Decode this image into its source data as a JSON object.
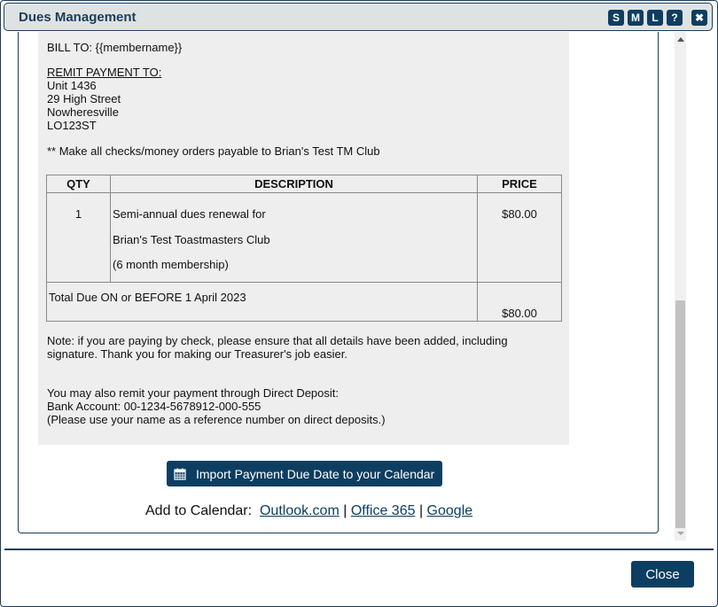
{
  "dialog": {
    "title": "Dues Management",
    "window_buttons": [
      {
        "label": "S",
        "name": "size-small-button"
      },
      {
        "label": "M",
        "name": "size-medium-button"
      },
      {
        "label": "L",
        "name": "size-large-button"
      },
      {
        "label": "?",
        "name": "help-button"
      },
      {
        "label": "✖",
        "name": "close-window-button"
      }
    ]
  },
  "invoice": {
    "bill_to": "BILL TO: {{membername}}",
    "remit_heading": "REMIT PAYMENT TO:",
    "address": [
      "Unit 1436",
      "29 High Street",
      "Nowheresville",
      "LO123ST"
    ],
    "payable_note": "** Make all checks/money orders payable to Brian's Test TM Club",
    "table": {
      "headers": [
        "QTY",
        "DESCRIPTION",
        "PRICE"
      ],
      "rows": [
        {
          "qty": "1",
          "description": [
            "Semi-annual dues renewal for",
            "Brian's Test Toastmasters Club",
            "(6 month membership)"
          ],
          "price": "$80.00"
        }
      ],
      "total_label": "Total Due ON or BEFORE 1 April 2023",
      "total_price": "$80.00"
    },
    "check_note": [
      "Note: if you are paying by check, please ensure that all details have been added, including",
      "signature. Thank you for making our Treasurer's job easier."
    ],
    "deposit": [
      "You may also remit your payment through Direct Deposit:",
      "Bank Account: 00-1234-5678912-000-555",
      "(Please use your name as a reference number on direct deposits.)"
    ]
  },
  "calendar": {
    "import_button": "Import Payment Due Date to your Calendar",
    "add_label": "Add to Calendar:",
    "links": [
      "Outlook.com",
      "Office 365",
      "Google"
    ],
    "separator": "|"
  },
  "footer": {
    "close_label": "Close"
  },
  "colors": {
    "primary": "#0d3e61",
    "invoice_bg": "#eeeeee",
    "titlebar_bg": "#dfe2e3"
  }
}
